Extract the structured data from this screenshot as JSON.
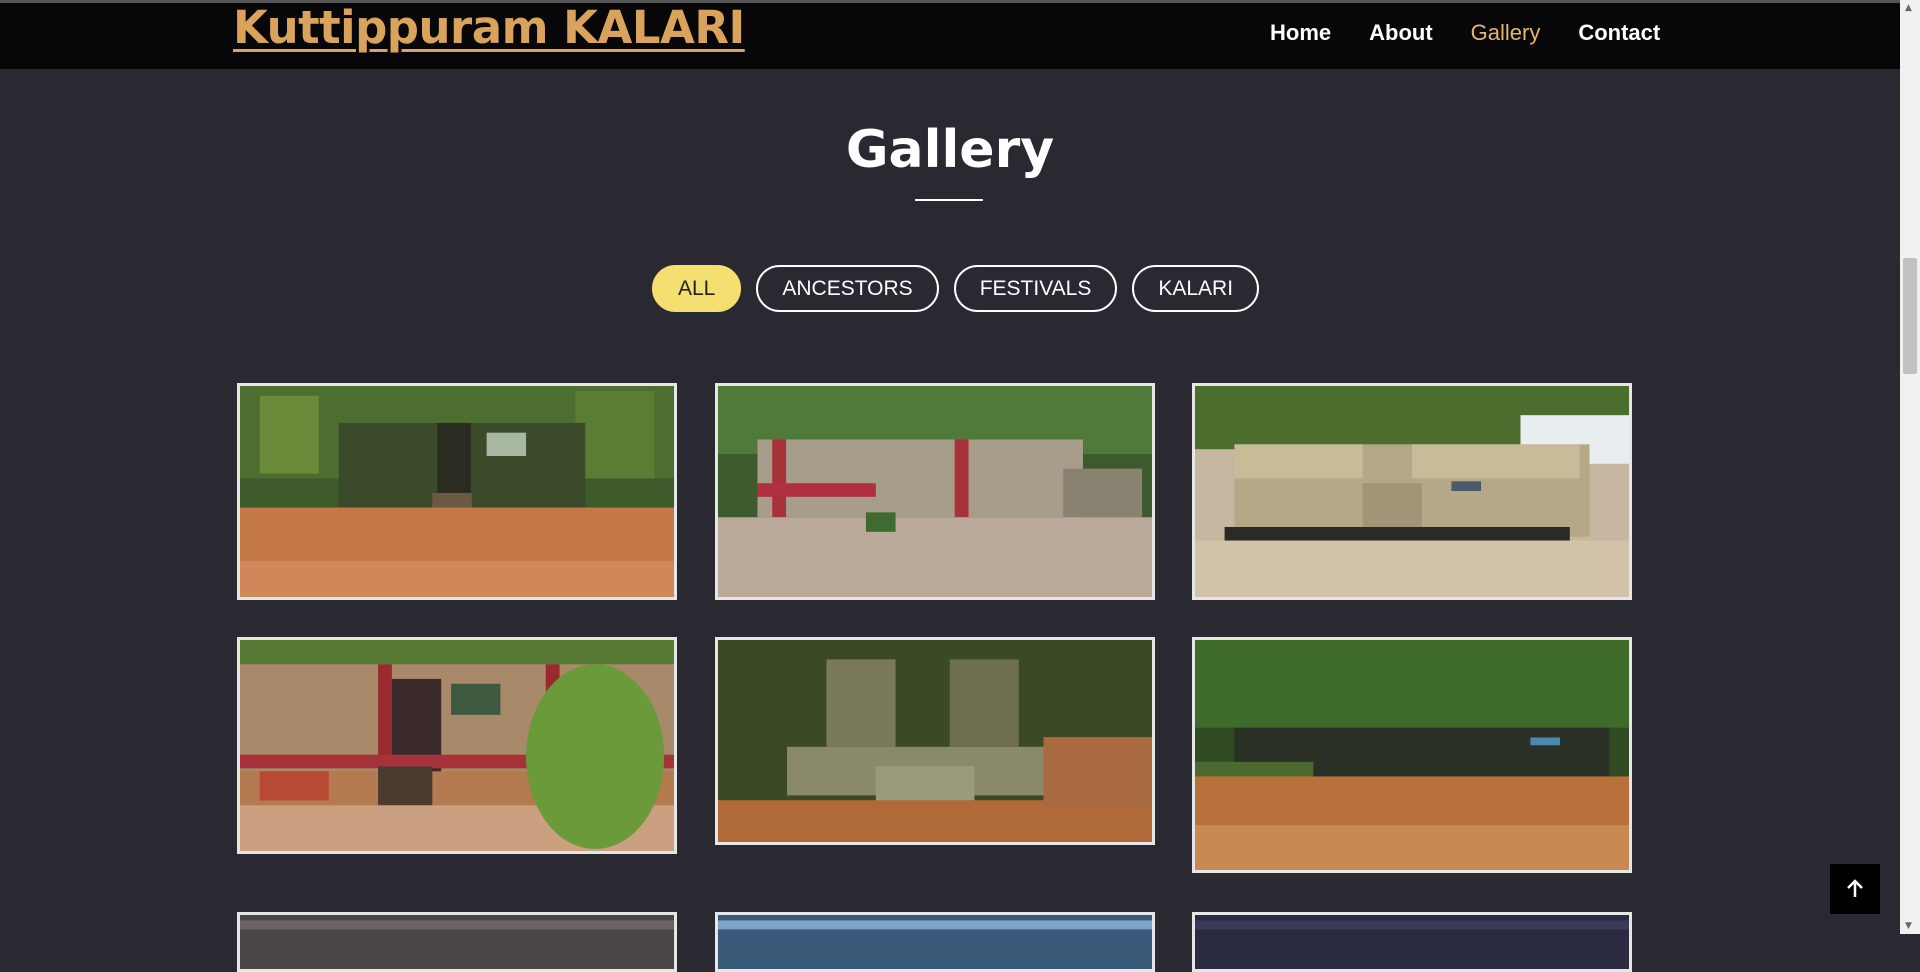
{
  "header": {
    "brand": "Kuttippuram KALARI",
    "nav": [
      {
        "label": "Home",
        "active": false
      },
      {
        "label": "About",
        "active": false
      },
      {
        "label": "Gallery",
        "active": true
      },
      {
        "label": "Contact",
        "active": false
      }
    ]
  },
  "section": {
    "title": "Gallery"
  },
  "filters": [
    {
      "label": "ALL",
      "active": true
    },
    {
      "label": "ANCESTORS",
      "active": false
    },
    {
      "label": "FESTIVALS",
      "active": false
    },
    {
      "label": "KALARI",
      "active": false
    }
  ],
  "gallery": {
    "photos": [
      {
        "name": "kalari-compound-gate"
      },
      {
        "name": "kalari-shrine-red-wall"
      },
      {
        "name": "kalari-stone-platforms"
      },
      {
        "name": "kalari-red-gate-closeup"
      },
      {
        "name": "kalari-mossy-shrine"
      },
      {
        "name": "kalari-open-ground"
      },
      {
        "name": "gallery-photo-7"
      },
      {
        "name": "gallery-photo-8"
      },
      {
        "name": "gallery-photo-9"
      }
    ]
  },
  "colors": {
    "background": "#2a2931",
    "navbar": "#07070a",
    "brand": "#d9a35b",
    "active_nav": "#e4b56a",
    "active_filter": "#f6df71"
  },
  "icons": {
    "back_to_top": "arrow-up-icon"
  }
}
